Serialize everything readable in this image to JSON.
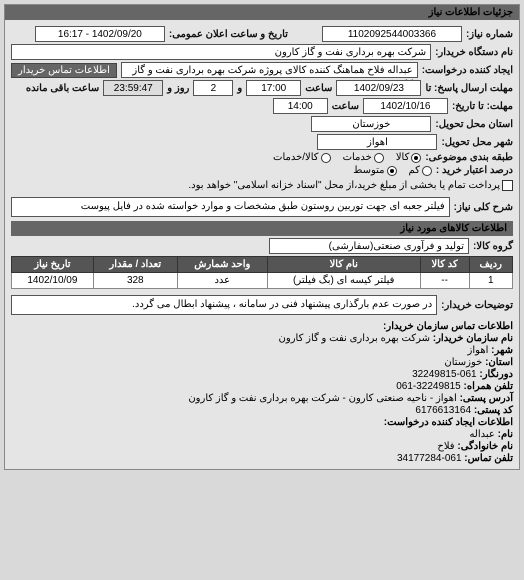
{
  "panel_title": "جزئیات اطلاعات نیاز",
  "labels": {
    "need_number": "شماره نیاز:",
    "public_announce": "تاریخ و ساعت اعلان عمومی:",
    "buyer_org": "نام دستگاه خریدار:",
    "requester": "ایجاد کننده درخواست:",
    "contact_btn": "اطلاعات تماس خریدار",
    "reply_deadline": "مهلت ارسال پاسخ: تا",
    "time": "ساعت",
    "and": "و",
    "day_remaining": "روز و",
    "time_remaining": "ساعت باقی مانده",
    "validity": "مهلت: تا تاریخ:",
    "delivery_province": "استان محل تحویل:",
    "delivery_city": "شهر محل تحویل:",
    "category": "طبقه بندی موضوعی:",
    "budget": "درصد اعتبار خرید :",
    "need_desc": "شرح کلی نیاز:",
    "items_header": "اطلاعات کالاهای مورد نیاز",
    "goods_group": "گروه کالا:",
    "buyer_notes": "توضیحات خریدار:",
    "contact_header": "اطلاعات تماس سازمان خریدار:",
    "org_name": "نام سازمان خریدار:",
    "city": "شهر:",
    "province": "استان:",
    "fax_switchboard": "دورنگار:",
    "switchboard": "تلفن همراه:",
    "postal_addr": "آدرس پستی:",
    "postal_code": "کد پستی:",
    "req_creator_header": "اطلاعات ایجاد کننده درخواست:",
    "name": "نام:",
    "family": "نام خانوادگی:",
    "phone": "تلفن تماس:"
  },
  "fields": {
    "need_number": "1102092544003366",
    "announce_datetime": "1402/09/20 - 16:17",
    "buyer_org": "شرکت بهره برداری نفت و گاز کارون",
    "requester": "عبداله فلاح هماهنگ کننده کالای پروژه شرکت بهره برداری نفت و گاز کارون",
    "reply_date": "1402/09/23",
    "reply_time": "17:00",
    "remaining_days": "2",
    "remaining_time": "23:59:47",
    "validity_date": "1402/10/16",
    "validity_time": "14:00",
    "province": "خوزستان",
    "city": "اهواز",
    "goods_group": "تولید و فرآوری صنعتی(سفارشی)"
  },
  "category_options": {
    "goods": "کالا",
    "services": "خدمات",
    "both": "کالا/خدمات"
  },
  "budget_options": {
    "low": "کم",
    "mid": "متوسط",
    "high": "پرداخت تمام یا بخشی از مبلغ خرید،از محل \"اسناد خزانه اسلامی\" خواهد بود."
  },
  "need_desc": "فیلتر جعبه ای جهت توربین روستون طبق مشخصات و موارد خواسته شده در فایل پیوست",
  "table": {
    "headers": {
      "row": "ردیف",
      "code": "کد کالا",
      "name": "نام کالا",
      "unit": "واحد شمارش",
      "qty": "تعداد / مقدار",
      "date": "تاریخ نیاز"
    },
    "rows": [
      {
        "row": "1",
        "code": "--",
        "name": "فیلتر کیسه ای (بگ فیلتر)",
        "unit": "عدد",
        "qty": "328",
        "date": "1402/10/09"
      }
    ]
  },
  "buyer_note": "در صورت عدم بارگذاری پیشنهاد فنی در سامانه ، پیشنهاد ابطال می گردد.",
  "contact": {
    "org_name": "شرکت بهره برداری نفت و گاز کارون",
    "city": "اهواز",
    "province": "خوزستان",
    "fax": "061-32249815",
    "switchboard": "32249815-061",
    "postal_addr": "اهواز - ناحیه صنعتی کارون - شرکت بهره برداری نفت و گاز کارون",
    "postal_code": "6176613164"
  },
  "creator": {
    "name": "عبداله",
    "family": "فلاح",
    "phone": "061-34177284"
  }
}
